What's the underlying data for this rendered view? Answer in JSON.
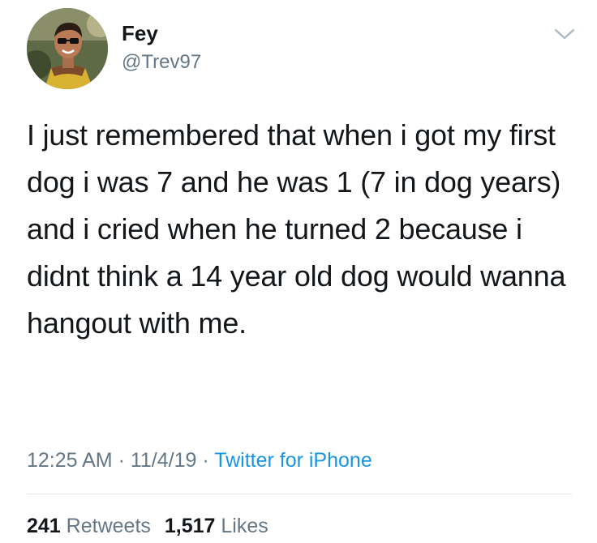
{
  "user": {
    "display_name": "Fey",
    "handle": "@Trev97"
  },
  "tweet": {
    "text": "I just remembered that when i got my first dog i was 7 and he was 1 (7 in dog years) and i cried when he turned 2 because i didnt think a 14 year old dog would wanna hangout with me."
  },
  "meta": {
    "time": "12:25 AM",
    "separator": " · ",
    "date": "11/4/19",
    "source": "Twitter for iPhone"
  },
  "stats": {
    "retweets_count": "241",
    "retweets_label": "Retweets",
    "likes_count": "1,517",
    "likes_label": "Likes"
  },
  "icons": {
    "menu": "chevron-down-icon"
  },
  "colors": {
    "text": "#14171a",
    "secondary": "#657786",
    "link": "#1b95e0",
    "divider": "#e1e8ed"
  }
}
